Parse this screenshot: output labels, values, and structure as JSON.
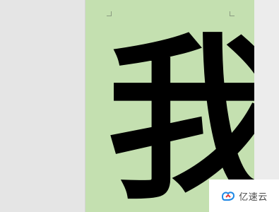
{
  "document": {
    "character": "我",
    "page_color": "#c4e0b0",
    "text_color": "#000000"
  },
  "workspace": {
    "background_color": "#e5e5e5"
  },
  "watermark": {
    "logo_icon": "yisu-cloud-logo-icon",
    "text": "亿速云",
    "logo_colors": [
      "#1e88e5",
      "#e53935"
    ]
  }
}
